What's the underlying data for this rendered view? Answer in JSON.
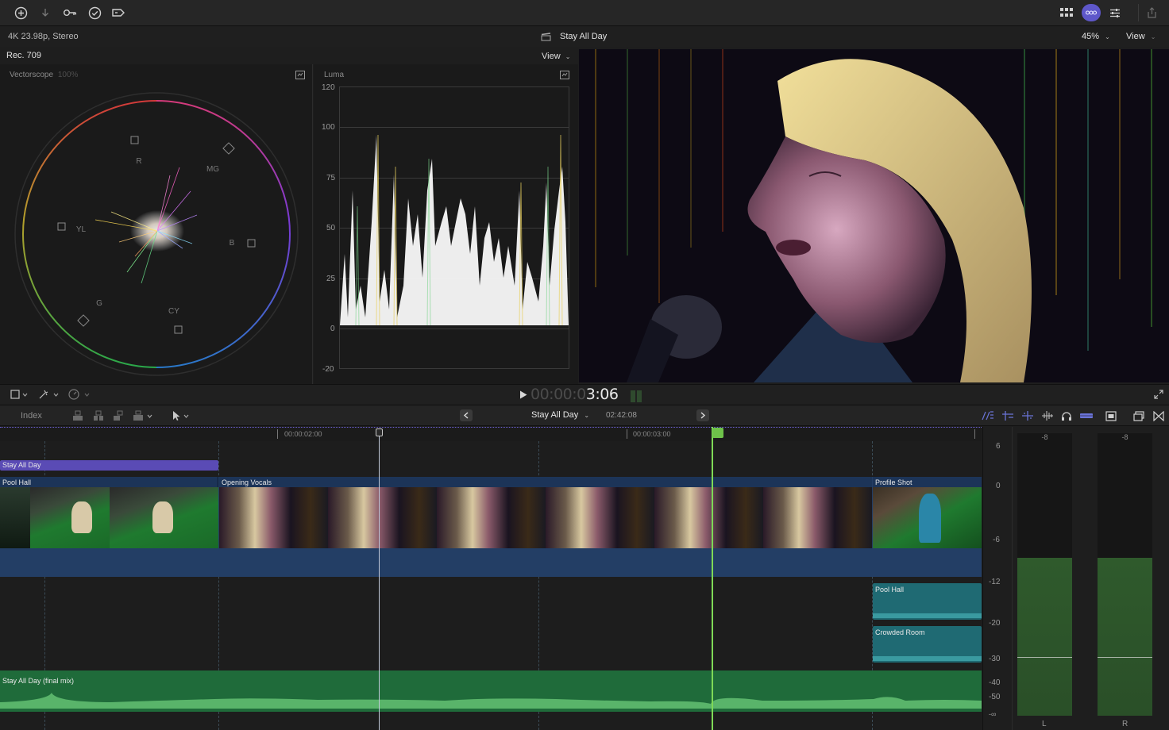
{
  "toolbar": {
    "left_icons": [
      "add-circle-icon",
      "download-arrow-icon",
      "key-icon",
      "checkmark-circle-icon",
      "tag-icon"
    ],
    "right_icons": [
      "grid-icon",
      "video-scopes-icon",
      "sliders-icon",
      "share-icon"
    ]
  },
  "infobar": {
    "format": "4K 23.98p, Stereo",
    "project_title": "Stay All Day",
    "zoom": "45%",
    "view": "View"
  },
  "scopes": {
    "colorspace": "Rec. 709",
    "view": "View",
    "vectorscope": {
      "title": "Vectorscope",
      "percent": "100%",
      "targets": [
        "R",
        "MG",
        "B",
        "CY",
        "G",
        "YL"
      ]
    },
    "luma": {
      "title": "Luma",
      "scale": [
        "120",
        "100",
        "75",
        "50",
        "25",
        "0",
        "-20"
      ]
    }
  },
  "transport": {
    "timecode_dim": "00:00:0",
    "timecode_bright": "3:06"
  },
  "timeline_toolbar": {
    "index": "Index",
    "project_name": "Stay All Day",
    "duration": "02:42:08"
  },
  "timeline": {
    "ruler": [
      "00:00:02:00",
      "00:00:03:00"
    ],
    "title_clip": "Stay All Day",
    "video_clips": [
      "Pool Hall",
      "Opening Vocals",
      "Profile Shot"
    ],
    "audio_clips": [
      "Pool Hall",
      "Crowded Room"
    ],
    "music_clip": "Stay All Day (final mix)"
  },
  "meters": {
    "scale": [
      "6",
      "0",
      "-6",
      "-12",
      "-20",
      "-30",
      "-40",
      "-50",
      "-∞"
    ],
    "peak_left": "-8",
    "peak_right": "-8",
    "channel_left": "L",
    "channel_right": "R",
    "level_db": -8
  },
  "colors": {
    "accent_purple": "#5e57c9",
    "playhead_green": "#7ed957",
    "clip_blue": "#22416b",
    "audio_teal": "#1f6a73",
    "music_green": "#1f6b3a"
  }
}
